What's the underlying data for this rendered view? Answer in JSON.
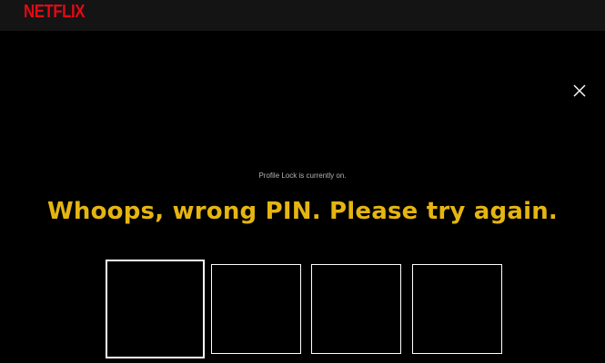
{
  "header": {
    "logo_text": "NETFLIX",
    "brand_color": "#e50914",
    "background_color": "#141414"
  },
  "dialog": {
    "close_icon": "close-icon",
    "notice": "Profile Lock is currently on.",
    "error_message": "Whoops, wrong PIN. Please try again.",
    "error_color": "#e5b511",
    "pin_inputs": [
      {
        "value": "",
        "focused": true
      },
      {
        "value": "",
        "focused": false
      },
      {
        "value": "",
        "focused": false
      },
      {
        "value": "",
        "focused": false
      }
    ]
  }
}
